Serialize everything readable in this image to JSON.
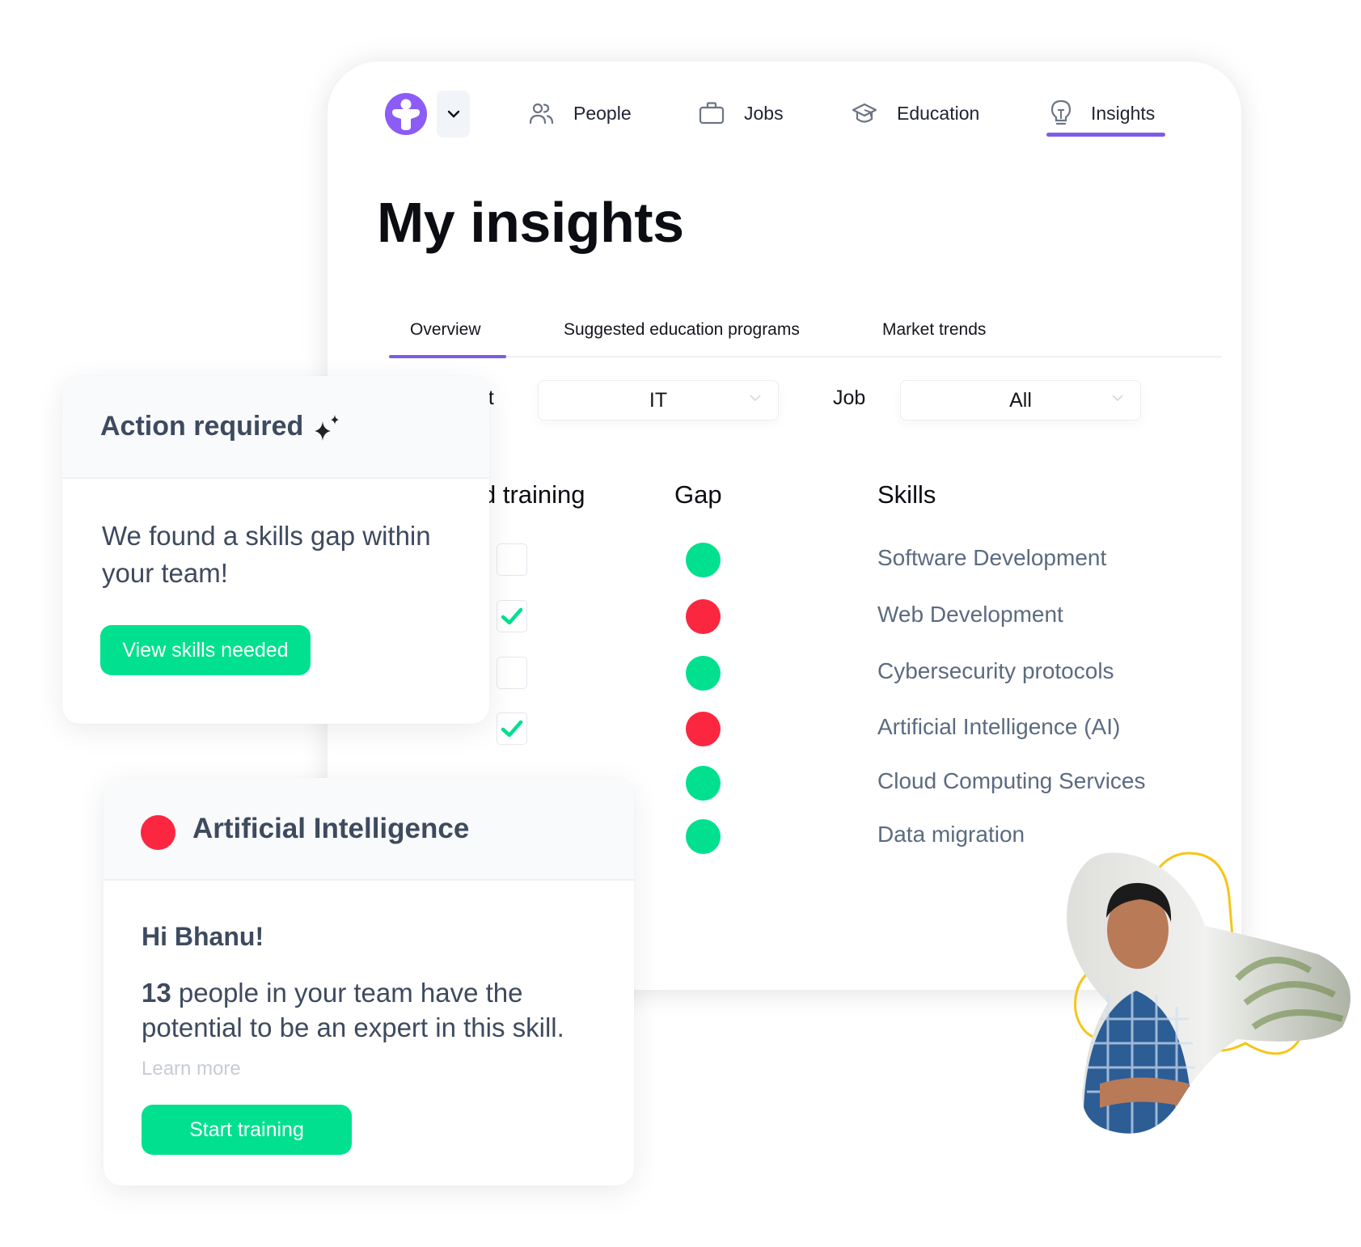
{
  "nav": {
    "logo_alt": "app-logo",
    "items": [
      {
        "label": "People",
        "icon": "people-icon"
      },
      {
        "label": "Jobs",
        "icon": "briefcase-icon"
      },
      {
        "label": "Education",
        "icon": "graduation-cap-icon"
      },
      {
        "label": "Insights",
        "icon": "lightbulb-icon",
        "active": true
      }
    ]
  },
  "page": {
    "title": "My insights"
  },
  "tabs": [
    {
      "label": "Overview",
      "active": true
    },
    {
      "label": "Suggested education programs"
    },
    {
      "label": "Market trends"
    }
  ],
  "filters": {
    "department_label_visible": "nt",
    "department_value": "IT",
    "job_label": "Job",
    "job_value": "All"
  },
  "table": {
    "headers": {
      "training_visible": "d training",
      "gap": "Gap",
      "skills": "Skills"
    },
    "rows": [
      {
        "skill": "Software Development",
        "training": false,
        "gap": "green"
      },
      {
        "skill": "Web Development",
        "training": true,
        "gap": "red"
      },
      {
        "skill": "Cybersecurity protocols",
        "training": false,
        "gap": "green"
      },
      {
        "skill": "Artificial Intelligence (AI)",
        "training": true,
        "gap": "red"
      },
      {
        "skill": "Cloud Computing Services",
        "training": null,
        "gap": "green"
      },
      {
        "skill": "Data migration",
        "training": null,
        "gap": "green"
      }
    ]
  },
  "action_card": {
    "title": "Action required",
    "message": "We found a skills gap within your team!",
    "button": "View skills needed"
  },
  "ai_card": {
    "title": "Artificial Intelligence",
    "greeting": "Hi Bhanu!",
    "count": "13",
    "message_rest": " people in your team have the potential to be an expert in this skill.",
    "learn_more": "Learn more",
    "button": "Start training"
  },
  "colors": {
    "accent": "#7c5ce8",
    "logo": "#8b5cf6",
    "success": "#00e08f",
    "danger": "#fb2640",
    "text_muted": "#5b6b80",
    "photo_outline": "#f5c518"
  }
}
